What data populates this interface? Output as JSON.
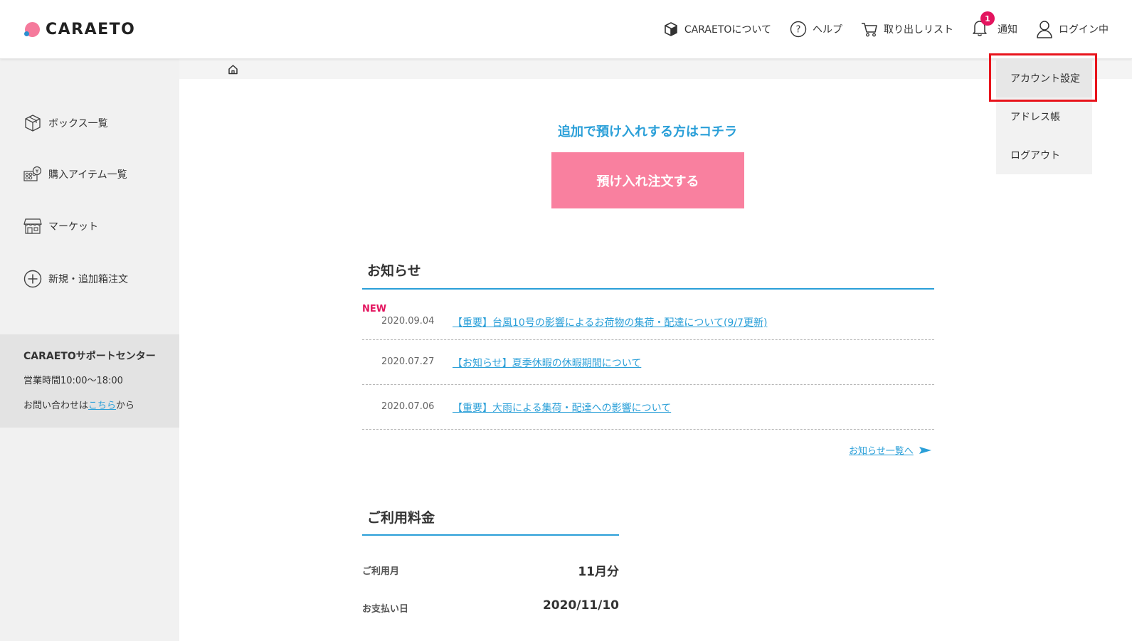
{
  "header": {
    "logo_text": "CARAETO",
    "nav": {
      "about": "CARAETOについて",
      "help": "ヘルプ",
      "takeout_list": "取り出しリスト",
      "notifications": "通知",
      "notification_count": "1",
      "login_status": "ログイン中"
    }
  },
  "account_menu": {
    "items": [
      "アカウント設定",
      "アドレス帳",
      "ログアウト"
    ],
    "highlighted": "アカウント設定"
  },
  "sidebar": {
    "items": [
      {
        "label": "ボックス一覧",
        "icon": "box-icon"
      },
      {
        "label": "購入アイテム一覧",
        "icon": "purchase-items-icon"
      },
      {
        "label": "マーケット",
        "icon": "market-store-icon"
      },
      {
        "label": "新規・追加箱注文",
        "icon": "plus-circle-icon"
      }
    ],
    "support": {
      "title": "CARAETOサポートセンター",
      "hours": "営業時間10:00〜18:00",
      "contact_prefix": "お問い合わせは",
      "contact_link": "こちら",
      "contact_suffix": "から"
    }
  },
  "main": {
    "cta_text": "追加で預け入れする方はコチラ",
    "cta_button": "預け入れ注文する",
    "news": {
      "title": "お知らせ",
      "new_label": "NEW",
      "items": [
        {
          "date": "2020.09.04",
          "title": "【重要】台風10号の影響によるお荷物の集荷・配達について(9/7更新)"
        },
        {
          "date": "2020.07.27",
          "title": "【お知らせ】夏季休暇の休暇期間について"
        },
        {
          "date": "2020.07.06",
          "title": "【重要】大雨による集荷・配達への影響について"
        }
      ],
      "more_link": "お知らせ一覧へ"
    },
    "fees": {
      "title": "ご利用料金",
      "rows": [
        {
          "label": "ご利用月",
          "value": "11月分"
        },
        {
          "label": "お支払い日",
          "value": "2020/11/10"
        }
      ]
    }
  },
  "colors": {
    "accent_blue": "#2a9fd8",
    "cta_pink": "#f9809f",
    "new_badge": "#e3145e",
    "highlight_red": "#e8141c"
  }
}
